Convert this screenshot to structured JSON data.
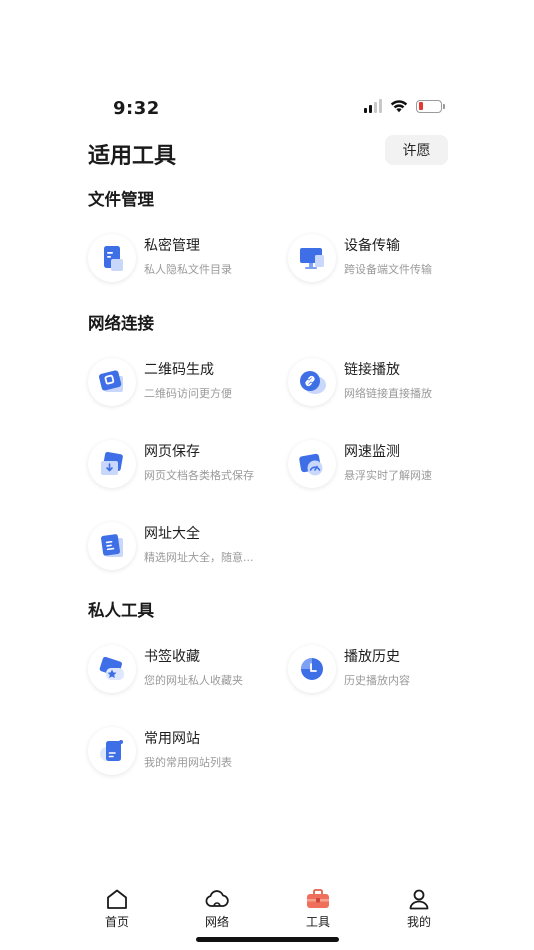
{
  "status": {
    "time": "9:32"
  },
  "header": {
    "title": "适用工具",
    "wish_label": "许愿"
  },
  "sections": [
    {
      "title": "文件管理",
      "items": [
        {
          "name": "私密管理",
          "desc": "私人隐私文件目录",
          "icon": "private-file-icon"
        },
        {
          "name": "设备传输",
          "desc": "跨设备端文件传输",
          "icon": "device-transfer-icon"
        }
      ]
    },
    {
      "title": "网络连接",
      "items": [
        {
          "name": "二维码生成",
          "desc": "二维码访问更方便",
          "icon": "qrcode-icon"
        },
        {
          "name": "链接播放",
          "desc": "网络链接直接播放",
          "icon": "link-play-icon"
        },
        {
          "name": "网页保存",
          "desc": "网页文档各类格式保存",
          "icon": "webpage-save-icon"
        },
        {
          "name": "网速监测",
          "desc": "悬浮实时了解网速",
          "icon": "speed-monitor-icon"
        },
        {
          "name": "网址大全",
          "desc": "精选网址大全，随意...",
          "icon": "url-directory-icon"
        }
      ]
    },
    {
      "title": "私人工具",
      "items": [
        {
          "name": "书签收藏",
          "desc": "您的网址私人收藏夹",
          "icon": "bookmark-icon"
        },
        {
          "name": "播放历史",
          "desc": "历史播放内容",
          "icon": "play-history-icon"
        },
        {
          "name": "常用网站",
          "desc": "我的常用网站列表",
          "icon": "common-sites-icon"
        }
      ]
    }
  ],
  "tabs": [
    {
      "label": "首页",
      "icon": "home-icon"
    },
    {
      "label": "网络",
      "icon": "cloud-icon"
    },
    {
      "label": "工具",
      "icon": "toolbox-icon",
      "active": true
    },
    {
      "label": "我的",
      "icon": "user-icon"
    }
  ],
  "colors": {
    "accent": "#3f6fe6",
    "accent_light": "#7ea0f5",
    "tab_active": "#ef6f5a",
    "battery_low": "#e5392f"
  }
}
